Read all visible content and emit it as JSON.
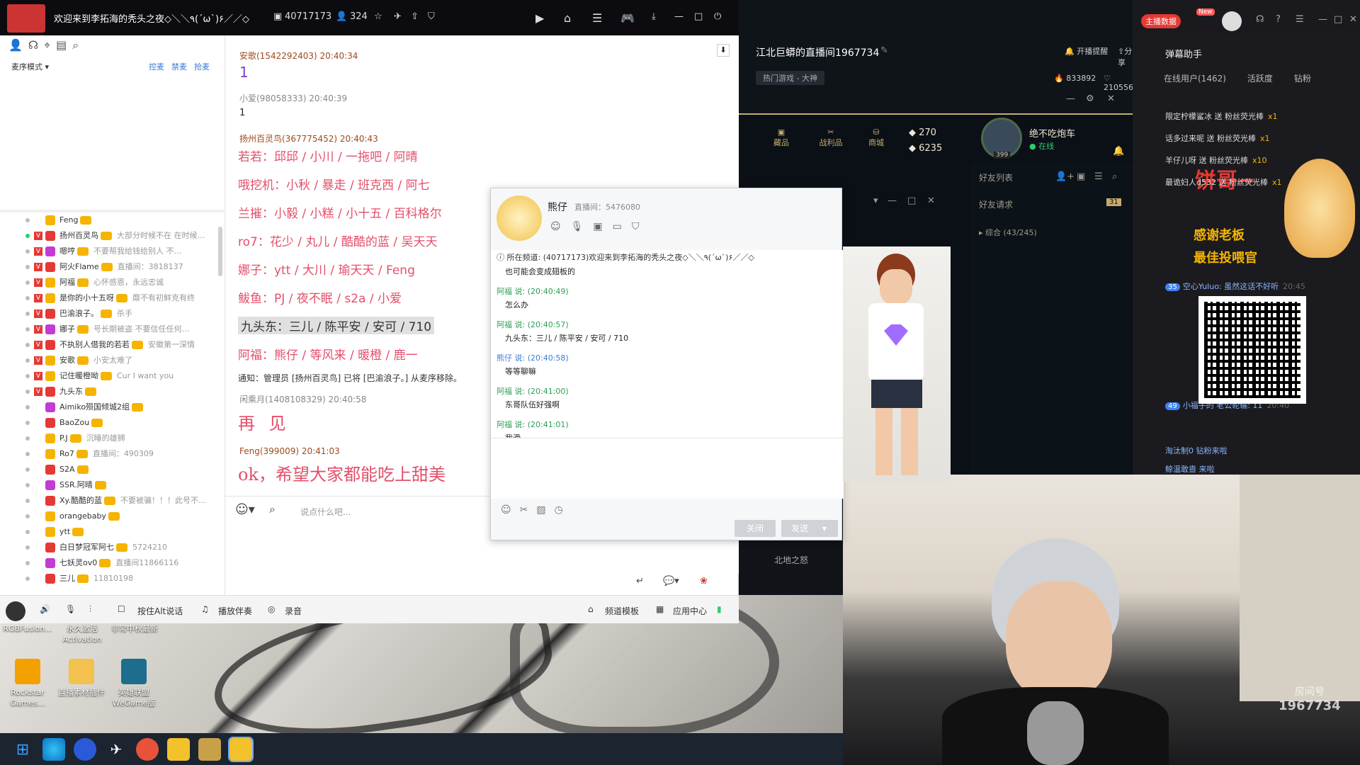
{
  "yy": {
    "title": "欢迎来到李拓海的秃头之夜◇＼＼٩(ˊωˋ)۶／／◇",
    "channel_id": "40717173",
    "online_count": "324",
    "mode_label": "麦序模式",
    "links": [
      "控麦",
      "禁麦",
      "抢麦"
    ],
    "users": [
      {
        "name": "Feng",
        "sig": "",
        "online": false,
        "v": false
      },
      {
        "name": "扬州百灵鸟",
        "sig": "大部分时候不在 在时候…",
        "online": true,
        "v": true
      },
      {
        "name": "嗯哼",
        "sig": "不要帮我给钱给别人 不…",
        "online": false,
        "v": true
      },
      {
        "name": "阿火Flame",
        "sig": "直播间：3818137",
        "online": false,
        "v": true
      },
      {
        "name": "阿福",
        "sig": "心怀感恩，永远忠诚",
        "online": false,
        "v": true
      },
      {
        "name": "是你的小十五呀",
        "sig": "靡不有初鲜克有终",
        "online": false,
        "v": true
      },
      {
        "name": "巴渝浪子。",
        "sig": "杀手",
        "online": false,
        "v": true
      },
      {
        "name": "娜子",
        "sig": "号长期被盗 不要信任任何…",
        "online": false,
        "v": true
      },
      {
        "name": "不执别人借我的若若",
        "sig": "安徽第一深情",
        "online": false,
        "v": true
      },
      {
        "name": "安歌",
        "sig": "小安太难了",
        "online": false,
        "v": true
      },
      {
        "name": "记住暖橙呦",
        "sig": "Cur I want you",
        "online": false,
        "v": true
      },
      {
        "name": "九头东",
        "sig": "",
        "online": false,
        "v": true
      },
      {
        "name": "Aimiko殒国倾城2组",
        "sig": "",
        "online": false,
        "v": false
      },
      {
        "name": "BaoZou",
        "sig": "",
        "online": false,
        "v": false
      },
      {
        "name": "P.J",
        "sig": "沉睡的雄狮",
        "online": false,
        "v": false
      },
      {
        "name": "Ro7",
        "sig": "直播间：490309",
        "online": false,
        "v": false
      },
      {
        "name": "S2A",
        "sig": "",
        "online": false,
        "v": false
      },
      {
        "name": "SSR.阿晴",
        "sig": "",
        "online": false,
        "v": false
      },
      {
        "name": "Xy.酷酷的蓝",
        "sig": "不要被骗！！！此号不…",
        "online": false,
        "v": false
      },
      {
        "name": "orangebaby",
        "sig": "",
        "online": false,
        "v": false
      },
      {
        "name": "ytt",
        "sig": "",
        "online": false,
        "v": false
      },
      {
        "name": "白日梦冠军阿七",
        "sig": "5724210",
        "online": false,
        "v": false
      },
      {
        "name": "七妖灵ov0",
        "sig": "直播间11866116",
        "online": false,
        "v": false
      },
      {
        "name": "三儿",
        "sig": "11810198",
        "online": false,
        "v": false
      }
    ],
    "chat": {
      "m1_head": "安歌(1542292403)  20:40:34",
      "m1_body": "1",
      "m2_head": "小爱(98058333)  20:40:39",
      "m2_body": "1",
      "m3_head": "扬州百灵鸟(367775452)  20:40:43",
      "lines": [
        "若若：邱邱 / 小川 / 一拖吧 / 阿晴",
        "哦挖机：小秋 / 暴走 / 班克西 / 阿七",
        "兰摧：小毅 / 小糕 / 小十五 / 百科格尔",
        "ro7：花少 / 丸儿 / 酷酷的蓝 / 吴天天",
        "娜子：ytt / 大川 / 瑜天天 / Feng",
        "鲅鱼：PJ / 夜不眠 / s2a / 小爱",
        "九头东：三儿 / 陈平安 / 安可 / 710",
        "阿福：熊仔 / 等风来 / 暖橙 / 鹿一"
      ],
      "notice": "通知：管理员 [扬州百灵鸟] 已将 [巴渝浪子。] 从麦序移除。",
      "m4_head": "闲乘月(1408108329)  20:40:58",
      "m4_body": "再 见",
      "m5_head": "Feng(399009)  20:41:03",
      "m5_body": "ok，希望大家都能吃上甜美",
      "input_placeholder": "说点什么吧..."
    },
    "bottom": {
      "talk": "按住Alt说话",
      "music": "播放伴奏",
      "record": "录音",
      "template": "频道模板",
      "apps": "应用中心"
    }
  },
  "pm": {
    "name": "熊仔",
    "room_label": "直播间：5476080",
    "channel_line": "所在频道: (40717173)欢迎来到李拓海的秃头之夜◇＼＼٩(ˊωˋ)۶／／◇",
    "lines": [
      {
        "who": "",
        "text": "也可能会变成翅板的"
      },
      {
        "who": "阿福 说: (20:40:49)",
        "text": "怎么办"
      },
      {
        "who": "阿福 说: (20:40:57)",
        "text": "九头东：三儿 / 陈平安 / 安可 / 710"
      },
      {
        "who": "熊仔 说: (20:40:58)",
        "text": "等等聊嘛"
      },
      {
        "who": "阿福 说: (20:41:00)",
        "text": "东哥队伍好强啊"
      },
      {
        "who": "阿福 说: (20:41:01)",
        "text": "我滑"
      }
    ],
    "close": "关闭",
    "send": "发送"
  },
  "lol": {
    "room_title": "江北巨蟒的直播间1967734",
    "tag": "热门游戏 - 大神",
    "notify": "开播提醒",
    "share": "分享",
    "hot": "833892",
    "likes": "210556",
    "nav": [
      "藏品",
      "战利品",
      "商城"
    ],
    "rp": "270",
    "be": "6235",
    "player": "绝不吃炮车",
    "status": "在线",
    "level": "399",
    "friends_title": "好友列表",
    "friend_req": "好友请求",
    "friend_req_count": "31",
    "group": "综合 (43/245)",
    "map": "北地之怒"
  },
  "douyu": {
    "anchor_data": "主播数据",
    "new": "New",
    "panel": "弹幕助手",
    "tabs": [
      "在线用户(1462)",
      "活跃度",
      "钻粉"
    ],
    "gifts": [
      {
        "text": "限定柠檬鲨冰 送 粉丝荧光棒",
        "qty": "x1"
      },
      {
        "text": "话多过来呢 送 粉丝荧光棒",
        "qty": "x1"
      },
      {
        "text": "羊仔儿呀 送 粉丝荧光棒",
        "qty": "x10"
      },
      {
        "text": "最诡妇人d532 送 粉丝荧光棒",
        "qty": "x1"
      }
    ],
    "big_text": "饼哥~",
    "thanks": "感谢老板",
    "support": "最佳投喂官",
    "chat": [
      {
        "lvl": "35",
        "text": "空心Yuluo: 虽然这话不好听",
        "time": "20:45"
      },
      {
        "lvl": "49",
        "text": "小福子的 老公轮输: 11",
        "time": "20:40"
      }
    ],
    "arrivals": [
      "淘汰制0 钻粉来啦",
      "鲸温敢啬 来啦"
    ],
    "room_label": "房间号",
    "room_no": "1967734"
  },
  "desktop": {
    "icons": [
      "RGBFusion...",
      "永久激活 Activation",
      "非常中秋最新",
      "Rockstar Games...",
      "直播素材插件",
      "英雄联盟 WeGame版"
    ]
  }
}
